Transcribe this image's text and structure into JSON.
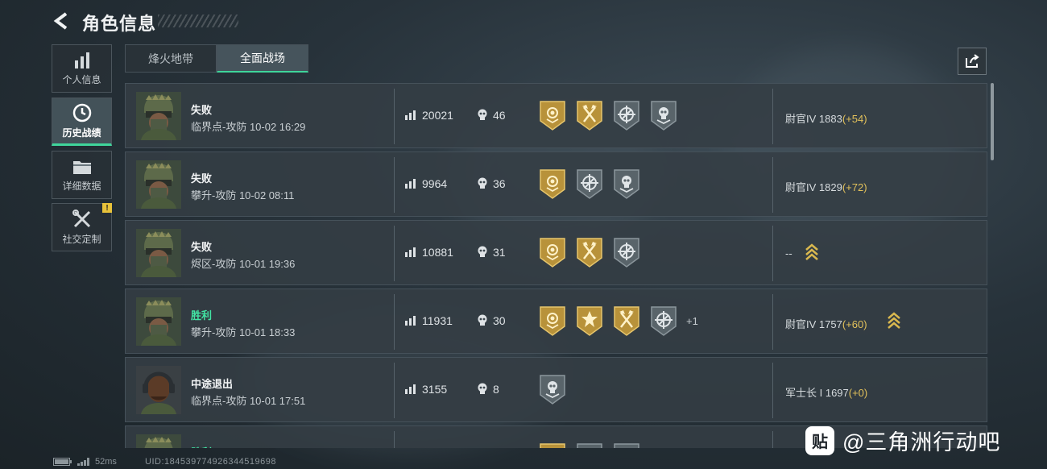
{
  "header": {
    "title": "角色信息"
  },
  "nav": [
    {
      "label": "个人信息",
      "icon": "bar-chart-icon",
      "active": false
    },
    {
      "label": "历史战绩",
      "icon": "clock-icon",
      "active": true
    },
    {
      "label": "详细数据",
      "icon": "folder-icon",
      "active": false
    },
    {
      "label": "社交定制",
      "icon": "tools-icon",
      "active": false,
      "badge": "!"
    }
  ],
  "tabs": [
    {
      "label": "烽火地带",
      "active": false
    },
    {
      "label": "全面战场",
      "active": true
    }
  ],
  "matches": [
    {
      "result": "失败",
      "win": false,
      "detail": "临界点-攻防 10-02 16:29",
      "score": "20021",
      "kills": "46",
      "medals": [
        "gold-rose",
        "gold-axe",
        "silver-target",
        "silver-skull"
      ],
      "extra": "",
      "rank": "尉官IV 1883",
      "delta": "(+54)",
      "chevron": false,
      "avatar": "helmet"
    },
    {
      "result": "失败",
      "win": false,
      "detail": "攀升-攻防 10-02 08:11",
      "score": "9964",
      "kills": "36",
      "medals": [
        "gold-rose",
        "silver-target",
        "silver-skull"
      ],
      "extra": "",
      "rank": "尉官IV 1829",
      "delta": "(+72)",
      "chevron": false,
      "avatar": "helmet"
    },
    {
      "result": "失败",
      "win": false,
      "detail": "烬区-攻防 10-01 19:36",
      "score": "10881",
      "kills": "31",
      "medals": [
        "gold-rose",
        "gold-axe",
        "silver-target"
      ],
      "extra": "",
      "rank": "--",
      "delta": "",
      "chevron": true,
      "avatar": "helmet"
    },
    {
      "result": "胜利",
      "win": true,
      "detail": "攀升-攻防 10-01 18:33",
      "score": "11931",
      "kills": "30",
      "medals": [
        "gold-rose",
        "gold-star",
        "gold-axe",
        "silver-target"
      ],
      "extra": "+1",
      "rank": "尉官IV 1757",
      "delta": "(+60)",
      "chevron": true,
      "avatar": "helmet"
    },
    {
      "result": "中途退出",
      "win": false,
      "detail": "临界点-攻防 10-01 17:51",
      "score": "3155",
      "kills": "8",
      "medals": [
        "silver-skull"
      ],
      "extra": "",
      "rank": "军士长 I 1697",
      "delta": "(+0)",
      "chevron": false,
      "avatar": "bald"
    },
    {
      "result": "胜利",
      "win": true,
      "detail": "",
      "score": "",
      "kills": "",
      "medals": [
        "gold-rose",
        "silver-target",
        "silver-skull"
      ],
      "extra": "",
      "rank": "",
      "delta": "",
      "chevron": false,
      "avatar": "helmet"
    }
  ],
  "footer": {
    "ping": "52ms",
    "uid": "UID:1845397749263445196​98"
  },
  "watermark": {
    "logo": "贴",
    "text": "@三角洲行动吧"
  },
  "colors": {
    "accent": "#3fd59b",
    "win": "#42e3a3",
    "gold": "#e2c15b"
  }
}
